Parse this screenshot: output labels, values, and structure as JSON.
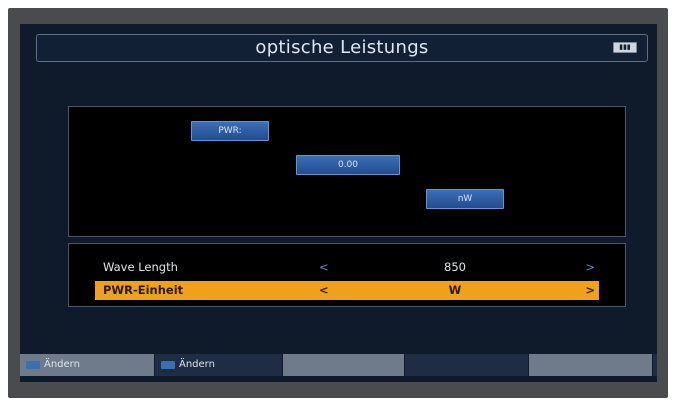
{
  "header": {
    "title": "optische Leistungs",
    "battery_label": "▮▮▮"
  },
  "chips": {
    "pwr": "PWR:",
    "value": "0.00",
    "unit": "nW"
  },
  "settings": {
    "rows": [
      {
        "label": "Wave Length",
        "left_arrow": "<",
        "value": "850",
        "right_arrow": ">"
      },
      {
        "label": "PWR-Einheit",
        "left_arrow": "<",
        "value": "W",
        "right_arrow": ">"
      }
    ]
  },
  "footer": {
    "buttons": [
      "Ändern",
      "Ändern",
      "",
      "",
      "",
      ""
    ]
  },
  "colors": {
    "selected_row": "#f0a11a",
    "chip_blue": "#2f5ea3",
    "background": "#0f1a2a"
  }
}
